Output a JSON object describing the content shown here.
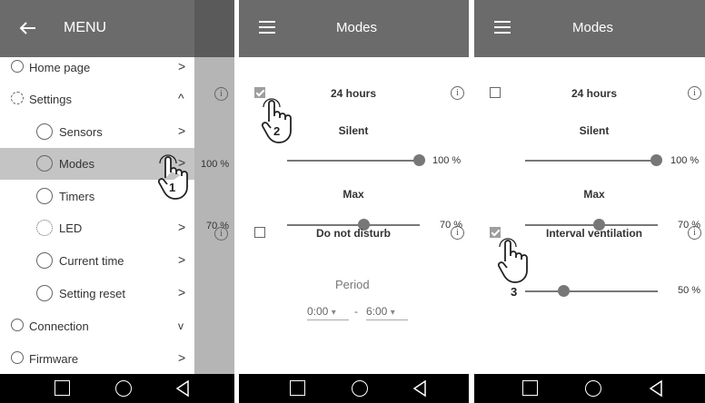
{
  "panel1": {
    "title": "MENU",
    "items": [
      {
        "label": "Home page",
        "chev": ">"
      },
      {
        "label": "Settings",
        "chev": "^"
      },
      {
        "label": "Sensors",
        "chev": ">"
      },
      {
        "label": "Modes",
        "chev": ">"
      },
      {
        "label": "Timers",
        "chev": ">"
      },
      {
        "label": "LED",
        "chev": ">"
      },
      {
        "label": "Current time",
        "chev": ">"
      },
      {
        "label": "Setting reset",
        "chev": ">"
      },
      {
        "label": "Connection",
        "chev": "v"
      },
      {
        "label": "Firmware",
        "chev": ">"
      }
    ],
    "overlay": {
      "pct_silent": "100 %",
      "pct_max": "70 %"
    },
    "step": "1"
  },
  "panel2": {
    "title": "Modes",
    "mode_24h": {
      "label": "24 hours",
      "checked": true
    },
    "silent": {
      "label": "Silent",
      "value": 100,
      "value_text": "100 %"
    },
    "max": {
      "label": "Max",
      "value": 70,
      "value_text": "70 %"
    },
    "dnd": {
      "label": "Do not disturb",
      "checked": false
    },
    "period": {
      "label": "Period",
      "from": "0:00",
      "to": "6:00",
      "sep": "-"
    },
    "step": "2"
  },
  "panel3": {
    "title": "Modes",
    "mode_24h": {
      "label": "24 hours",
      "checked": false
    },
    "silent": {
      "label": "Silent",
      "value": 100,
      "value_text": "100 %"
    },
    "max": {
      "label": "Max",
      "value": 70,
      "value_text": "70 %"
    },
    "interval": {
      "label": "Interval ventilation",
      "checked": true,
      "value": 50,
      "value_text": "50 %"
    },
    "step": "3"
  },
  "info_symbol": "i",
  "dropdown_caret": "▾",
  "icons": {
    "back": "arrow-left-icon",
    "menu": "hamburger-menu-icon",
    "nav_recent": "square-icon",
    "nav_home": "circle-icon",
    "nav_back": "triangle-back-icon",
    "tap": "hand-pointer-icon"
  },
  "colors": {
    "topbar": "#6b6b6b",
    "navbar": "#000000",
    "highlight": "#c4c4c4"
  }
}
